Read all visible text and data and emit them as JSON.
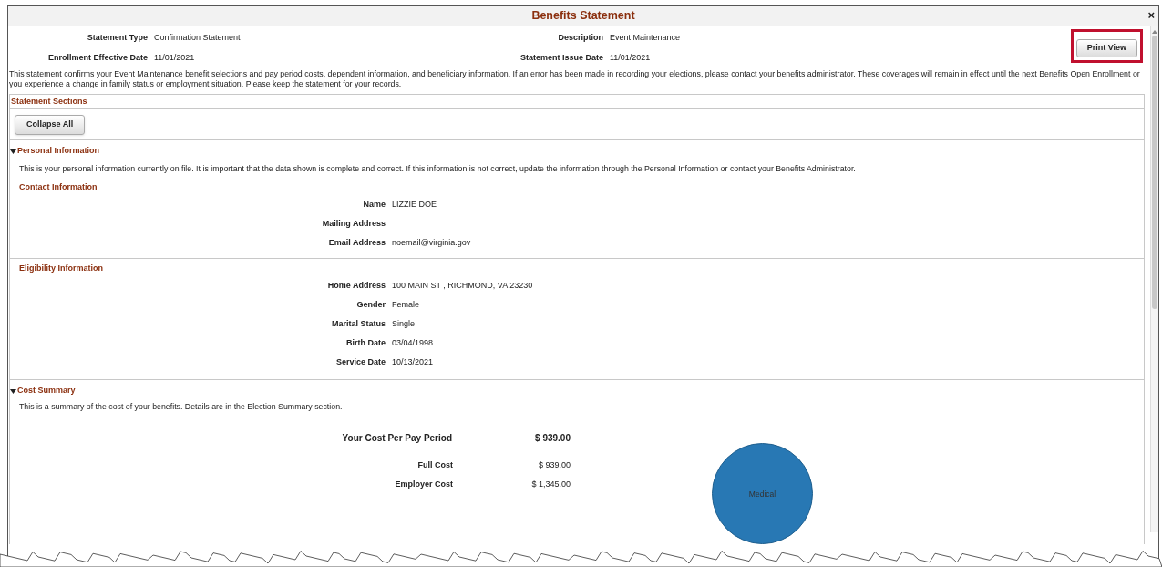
{
  "window": {
    "title": "Benefits Statement",
    "close": "×"
  },
  "header_fields": [
    {
      "label": "Statement Type",
      "value": "Confirmation Statement"
    },
    {
      "label": "Description",
      "value": "Event Maintenance"
    },
    {
      "label": "Enrollment Effective Date",
      "value": "11/01/2021"
    },
    {
      "label": "Statement Issue Date",
      "value": "11/01/2021"
    }
  ],
  "print_button": "Print View",
  "intro": "This statement confirms your Event Maintenance benefit selections and pay period costs, dependent information, and beneficiary information. If an error has been made in recording your elections, please contact your benefits administrator. These coverages will remain in effect until the next Benefits Open Enrollment or you experience a change in family status or employment situation. Please keep the statement for your records.",
  "statement_sections": {
    "title": "Statement Sections",
    "collapse_button": "Collapse All"
  },
  "personal_information": {
    "title": "Personal Information",
    "expanded": true,
    "description": "This is your personal information currently on file.  It is important that the data shown is complete and correct.  If this information is not correct, update the information through the Personal Information or contact your Benefits Administrator.",
    "groups": [
      {
        "title": "Contact Information",
        "fields": [
          {
            "label": "Name",
            "value": "LIZZIE DOE"
          },
          {
            "label": "Mailing Address"
          },
          {
            "label": "Email Address",
            "value": "noemail@virginia.gov"
          }
        ]
      },
      {
        "title": "Eligibility Information",
        "fields": [
          {
            "label": "Home Address",
            "value": "100 MAIN ST , RICHMOND, VA 23230"
          },
          {
            "label": "Gender",
            "value": "Female"
          },
          {
            "label": "Marital Status",
            "value": "Single"
          },
          {
            "label": "Birth Date",
            "value": "03/04/1998"
          },
          {
            "label": "Service Date",
            "value": "10/13/2021"
          }
        ]
      }
    ]
  },
  "cost_summary": {
    "title": "Cost Summary",
    "expanded": true,
    "description": "This is a summary of the cost of your benefits. Details are in the Election Summary section.",
    "total": {
      "label": "Your Cost Per Pay Period",
      "value": "$ 939.00"
    },
    "rows": [
      {
        "label": "Full Cost",
        "value": "$ 939.00"
      },
      {
        "label": "Employer Cost",
        "value": "$ 1,345.00"
      }
    ],
    "pie_label": "Medical"
  }
}
